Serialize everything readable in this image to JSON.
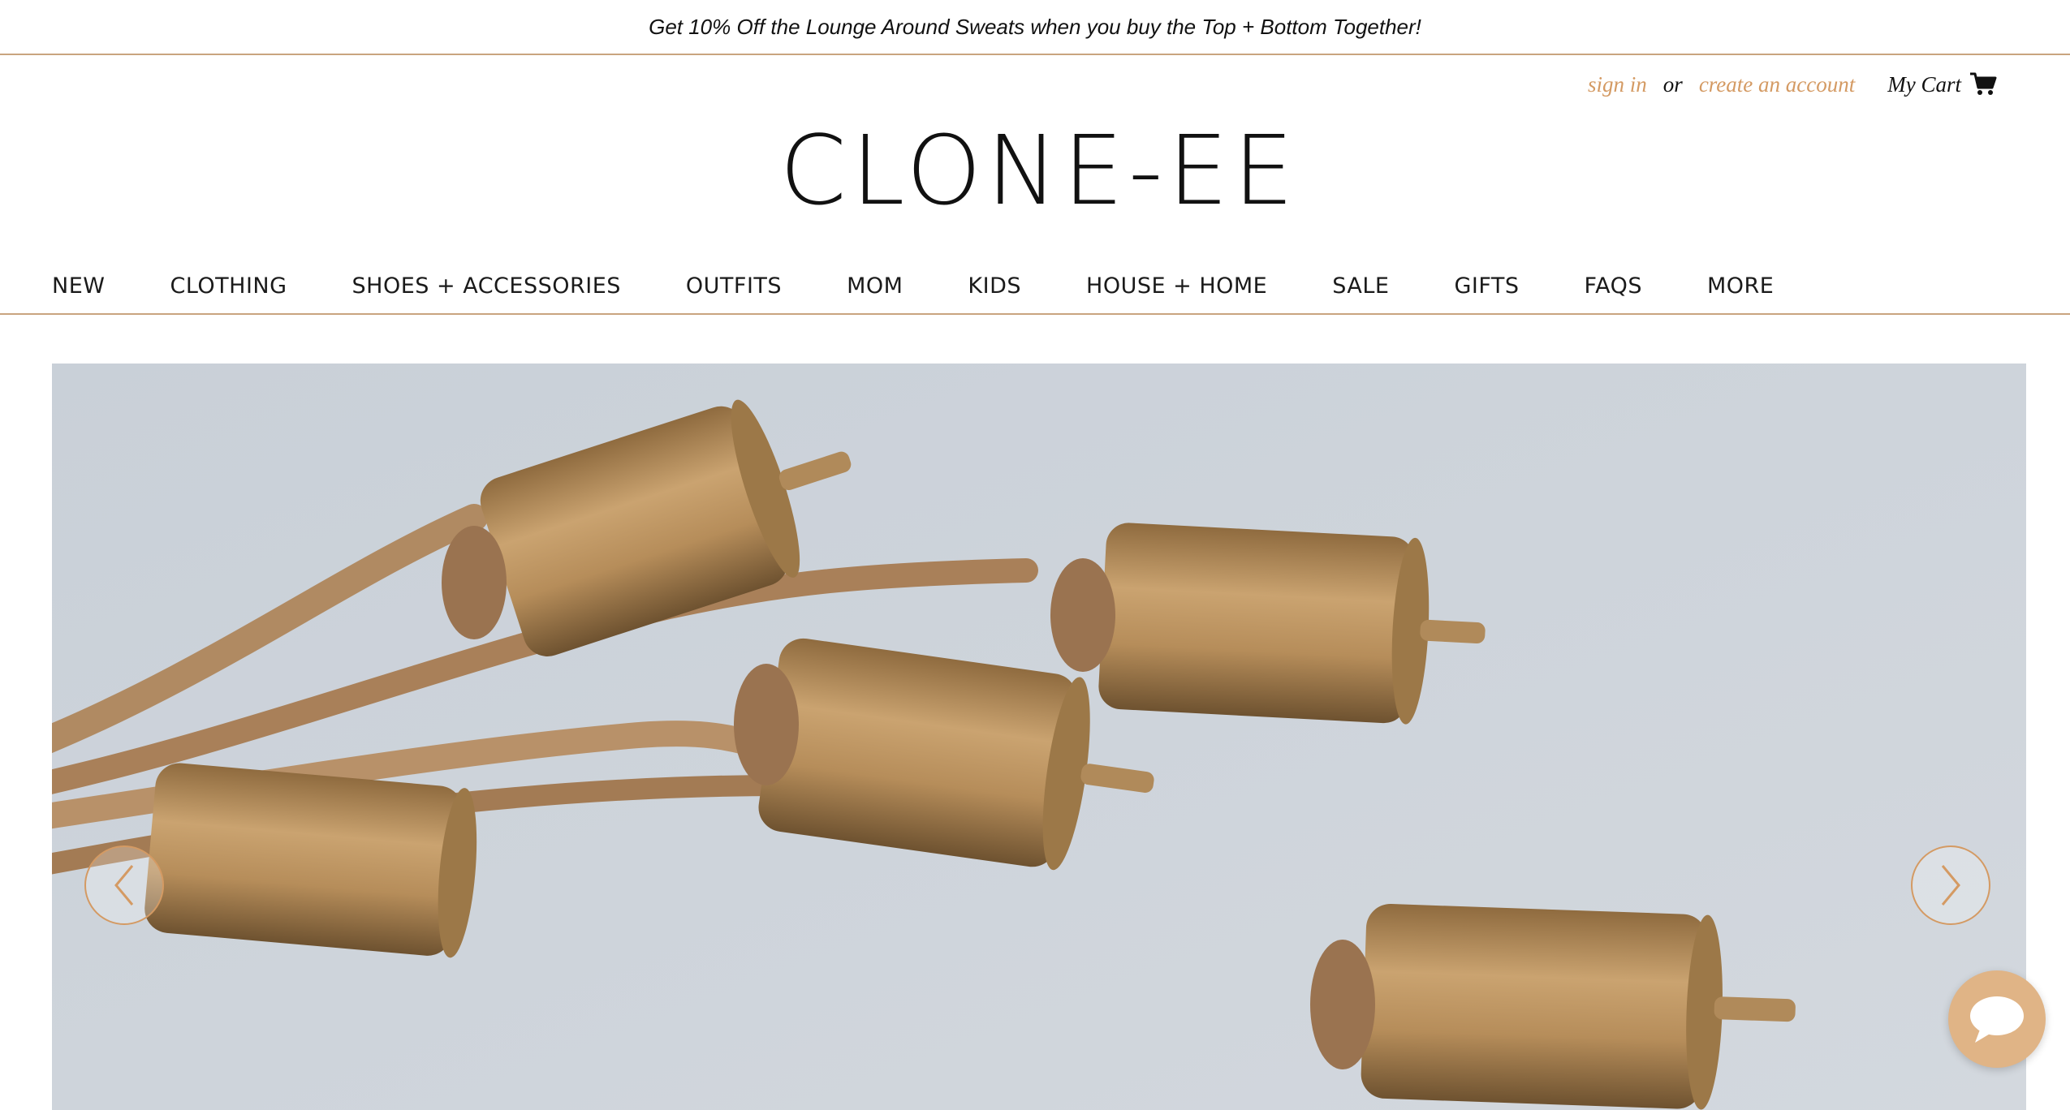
{
  "announcement": {
    "text": "Get 10% Off the Lounge Around Sweats when you buy the Top + Bottom Together!"
  },
  "account": {
    "sign_in": "sign in",
    "or": "or",
    "create_account": "create an account",
    "cart_label": "My Cart",
    "cart_icon": "cart-icon"
  },
  "logo": {
    "text": "CLONE-EE"
  },
  "nav": {
    "items": [
      {
        "label": "NEW"
      },
      {
        "label": "CLOTHING"
      },
      {
        "label": "SHOES + ACCESSORIES"
      },
      {
        "label": "OUTFITS"
      },
      {
        "label": "MOM"
      },
      {
        "label": "KIDS"
      },
      {
        "label": "HOUSE + HOME"
      },
      {
        "label": "SALE"
      },
      {
        "label": "GIFTS"
      },
      {
        "label": "FAQS"
      },
      {
        "label": "MORE"
      }
    ]
  },
  "hero": {
    "prev_icon": "chevron-left-icon",
    "next_icon": "chevron-right-icon"
  },
  "chat": {
    "icon": "chat-bubble-icon"
  },
  "colors": {
    "accent": "#d49a63",
    "divider": "#c9a47f",
    "hero_bg": "#cdd3da",
    "chat_bg": "#e0b486"
  }
}
